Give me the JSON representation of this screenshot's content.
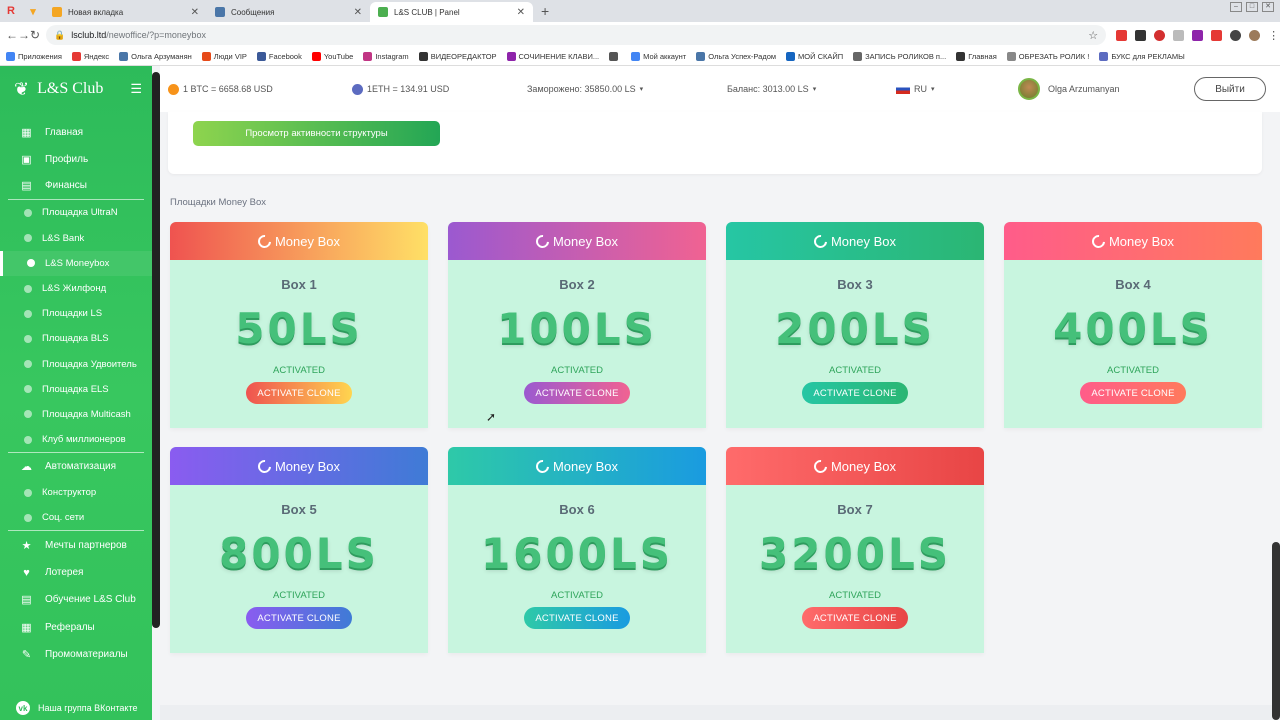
{
  "browser": {
    "tabs": [
      {
        "label": "Новая вкладка",
        "active": false,
        "color": "#f4a623"
      },
      {
        "label": "Сообщения",
        "active": false,
        "color": "#4a76a8"
      },
      {
        "label": "L&S CLUB | Panel",
        "active": true,
        "color": "#4caf50"
      }
    ],
    "url_host": "lsclub.ltd",
    "url_path": "/newoffice/?p=moneybox",
    "bookmarks": [
      "Приложения",
      "Яндекс",
      "Ольга Арзуманян",
      "Люди VIP",
      "Facebook",
      "YouTube",
      "Instagram",
      "ВИДЕОРЕДАКТОР",
      "СОЧИНЕНИЕ КЛАВИ...",
      "",
      "Мой аккаунт",
      "Ольга Успех-Радом",
      "МОЙ СКАЙП",
      "ЗАПИСЬ РОЛИКОВ п...",
      "Главная",
      "ОБРЕЗАТЬ РОЛИК !",
      "БУКС для РЕКЛАМЫ"
    ]
  },
  "sidebar": {
    "brand": "L&S Club",
    "items": [
      {
        "label": "Главная",
        "icon": "home-icon",
        "type": "main"
      },
      {
        "label": "Профиль",
        "icon": "profile-icon",
        "type": "main"
      },
      {
        "label": "Финансы",
        "icon": "finance-icon",
        "type": "main"
      },
      {
        "label": "Площадка UltraN",
        "type": "sub"
      },
      {
        "label": "L&S Bank",
        "type": "sub"
      },
      {
        "label": "L&S Moneybox",
        "type": "sub",
        "active": true
      },
      {
        "label": "L&S Жилфонд",
        "type": "sub"
      },
      {
        "label": "Площадки LS",
        "type": "sub"
      },
      {
        "label": "Площадка BLS",
        "type": "sub"
      },
      {
        "label": "Площадка Удвоитель",
        "type": "sub"
      },
      {
        "label": "Площадка ELS",
        "type": "sub"
      },
      {
        "label": "Площадка Multicash",
        "type": "sub"
      },
      {
        "label": "Клуб миллионеров",
        "type": "sub"
      },
      {
        "label": "Автоматизация",
        "icon": "automation-icon",
        "type": "main"
      },
      {
        "label": "Конструктор",
        "type": "sub"
      },
      {
        "label": "Соц. сети",
        "type": "sub"
      },
      {
        "label": "Мечты партнеров",
        "icon": "star-icon",
        "type": "main"
      },
      {
        "label": "Лотерея",
        "icon": "heart-icon",
        "type": "main"
      },
      {
        "label": "Обучение L&S Club",
        "icon": "education-icon",
        "type": "main"
      },
      {
        "label": "Рефералы",
        "icon": "referrals-icon",
        "type": "main"
      },
      {
        "label": "Промоматериалы",
        "icon": "promo-icon",
        "type": "main"
      }
    ],
    "bottom": "Наша группа ВКонтакте"
  },
  "header": {
    "btc": "1 BTC = 6658.68 USD",
    "eth": "1ETH = 134.91 USD",
    "frozen": "Заморожено: 35850.00 LS",
    "balance": "Баланс: 3013.00 LS",
    "lang": "RU",
    "user": "Olga Arzumanyan",
    "logout": "Выйти"
  },
  "main": {
    "structure_button": "Просмотр активности структуры",
    "section_title": "Площадки Money Box",
    "boxes": [
      {
        "head": "Money Box",
        "name": "Box 1",
        "amount": "50LS",
        "status": "ACTIVATED",
        "button": "ACTIVATE CLONE",
        "grad": [
          "#ef5350",
          "#ffe066"
        ],
        "btn": [
          "#ef5350",
          "#ffd54f"
        ]
      },
      {
        "head": "Money Box",
        "name": "Box 2",
        "amount": "100LS",
        "status": "ACTIVATED",
        "button": "ACTIVATE CLONE",
        "grad": [
          "#9b59d0",
          "#f06292"
        ],
        "btn": [
          "#9b59d0",
          "#f06292"
        ]
      },
      {
        "head": "Money Box",
        "name": "Box 3",
        "amount": "200LS",
        "status": "ACTIVATED",
        "button": "ACTIVATE CLONE",
        "grad": [
          "#26c6a4",
          "#2bb673"
        ],
        "btn": [
          "#26c6a4",
          "#2bb673"
        ]
      },
      {
        "head": "Money Box",
        "name": "Box 4",
        "amount": "400LS",
        "status": "ACTIVATED",
        "button": "ACTIVATE CLONE",
        "grad": [
          "#ff5c8a",
          "#ff7a5c"
        ],
        "btn": [
          "#ff5c8a",
          "#ff7a5c"
        ]
      },
      {
        "head": "Money Box",
        "name": "Box 5",
        "amount": "800LS",
        "status": "ACTIVATED",
        "button": "ACTIVATE CLONE",
        "grad": [
          "#8a5cf0",
          "#3f7bd6"
        ],
        "btn": [
          "#8a5cf0",
          "#3f7bd6"
        ]
      },
      {
        "head": "Money Box",
        "name": "Box 6",
        "amount": "1600LS",
        "status": "ACTIVATED",
        "button": "ACTIVATE CLONE",
        "grad": [
          "#2ec9a8",
          "#1a9be0"
        ],
        "btn": [
          "#2ec9a8",
          "#1a9be0"
        ]
      },
      {
        "head": "Money Box",
        "name": "Box 7",
        "amount": "3200LS",
        "status": "ACTIVATED",
        "button": "ACTIVATE CLONE",
        "grad": [
          "#ff6b6b",
          "#e84545"
        ],
        "btn": [
          "#ff6b6b",
          "#e84545"
        ]
      }
    ]
  }
}
